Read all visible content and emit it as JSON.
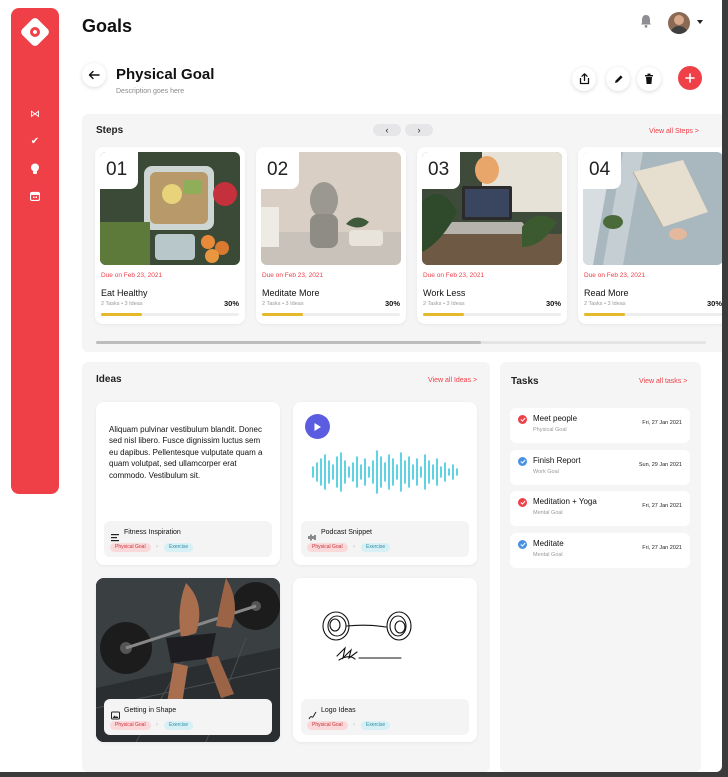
{
  "app": {
    "title": "Goals"
  },
  "header": {
    "bell_icon": "bell-icon",
    "avatar_icon": "user-avatar",
    "menu_caret": "chevron-down-icon"
  },
  "colors": {
    "accent": "#ef4048",
    "progress": "#e5b92a",
    "play": "#5c5ce0",
    "check_blue": "#4a90e2"
  },
  "sidebar": {
    "logo": "brand-logo",
    "items": [
      {
        "icon": "bowtie-icon",
        "glyph": "⋈"
      },
      {
        "icon": "check-icon",
        "glyph": "✔"
      },
      {
        "icon": "lightbulb-icon",
        "glyph": "●"
      },
      {
        "icon": "calendar-icon",
        "glyph": "▦"
      }
    ]
  },
  "goal": {
    "title": "Physical Goal",
    "description": "Description goes here",
    "actions": [
      "share-icon",
      "edit-icon",
      "delete-icon",
      "add-icon"
    ]
  },
  "steps": {
    "title": "Steps",
    "prev": "‹",
    "next": "›",
    "view_all": "View all Steps >",
    "items": [
      {
        "num": "01",
        "due": "Due on Feb 23, 2021",
        "name": "Eat Healthy",
        "meta": "2 Tasks • 3 Ideas",
        "progress_label": "30%",
        "progress": 0.3,
        "photo": "meal-prep-photo"
      },
      {
        "num": "02",
        "due": "Due on Feb 23, 2021",
        "name": "Meditate More",
        "meta": "2 Tasks • 3 Ideas",
        "progress_label": "30%",
        "progress": 0.3,
        "photo": "buddha-statue-photo"
      },
      {
        "num": "03",
        "due": "Due on Feb 23, 2021",
        "name": "Work Less",
        "meta": "2 Tasks • 3 Ideas",
        "progress_label": "30%",
        "progress": 0.3,
        "photo": "laptop-desk-photo"
      },
      {
        "num": "04",
        "due": "Due on Feb 23, 2021",
        "name": "Read More",
        "meta": "2 Tasks • 3 Ideas",
        "progress_label": "30%",
        "progress": 0.3,
        "photo": "reading-book-photo"
      }
    ]
  },
  "ideas": {
    "title": "Ideas",
    "view_all": "View all Ideas >",
    "cards": [
      {
        "type": "text",
        "quote": "Aliquam pulvinar vestibulum blandit. Donec sed nisl libero. Fusce dignissim luctus sem eu dapibus. Pellentesque vulputate quam a quam volutpat, sed ullamcorper erat commodo. Vestibulum sit.",
        "title": "Fitness Inspiration",
        "icon": "text-lines-icon",
        "tags": [
          "Physical Goal",
          "Exercise"
        ]
      },
      {
        "type": "audio",
        "title": "Podcast Snippet",
        "icon": "waveform-icon",
        "tags": [
          "Physical Goal",
          "Exercise"
        ]
      },
      {
        "type": "image",
        "title": "Getting in Shape",
        "icon": "image-icon",
        "tags": [
          "Physical Goal",
          "Exercise"
        ]
      },
      {
        "type": "drawing",
        "title": "Logo Ideas",
        "icon": "pen-icon",
        "tags": [
          "Physical Goal",
          "Exercise"
        ]
      }
    ]
  },
  "tasks": {
    "title": "Tasks",
    "view_all": "View all tasks >",
    "items": [
      {
        "name": "Meet people",
        "sub": "Physical Goal",
        "date": "Fri, 27 Jan 2021",
        "color": "#ef4048"
      },
      {
        "name": "Finish Report",
        "sub": "Work Goal",
        "date": "Sun, 29 Jan 2021",
        "color": "#4a90e2"
      },
      {
        "name": "Meditation + Yoga",
        "sub": "Mental Goal",
        "date": "Fri, 27 Jan 2021",
        "color": "#ef4048"
      },
      {
        "name": "Meditate",
        "sub": "Mental Goal",
        "date": "Fri, 27 Jan 2021",
        "color": "#4a90e2"
      }
    ]
  }
}
